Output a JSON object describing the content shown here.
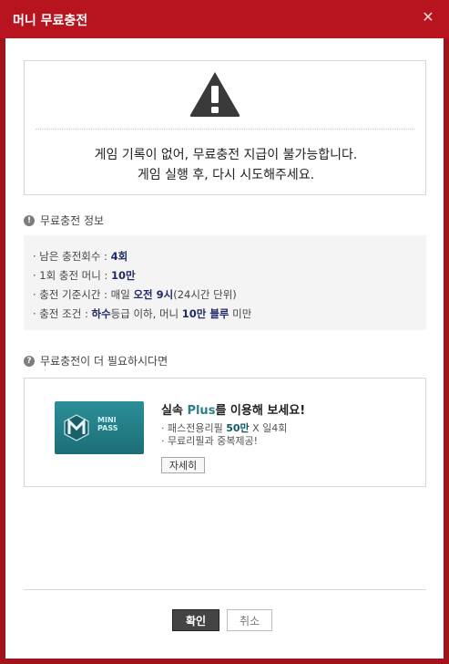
{
  "window": {
    "title": "머니 무료충전",
    "close_icon": "close-icon"
  },
  "notice": {
    "icon": "warning-icon",
    "line1": "게임 기록이 없어, 무료충전 지급이 불가능합니다.",
    "line2": "게임 실행 후, 다시 시도해주세요."
  },
  "info_section": {
    "heading": "무료충전 정보",
    "icon": "info-icon",
    "rows": [
      {
        "label": "· 남은 충전회수 : ",
        "value": "4회",
        "rest": ""
      },
      {
        "label": "· 1회 충전 머니 : ",
        "value": "10만",
        "rest": ""
      },
      {
        "label": "· 충전 기준시간 : 매일 ",
        "value": "오전 9시",
        "rest": "(24시간 단위)"
      },
      {
        "label": "· 충전 조건 : ",
        "value": "하수",
        "mid": "등급 이하, 머니 ",
        "value2": "10만 블루",
        "rest": " 미만"
      }
    ]
  },
  "pass_section": {
    "heading": "무료충전이 더 필요하시다면",
    "icon": "question-icon",
    "logo_text1": "MINI",
    "logo_text2": "PASS",
    "title_prefix": "실속 ",
    "title_plus": "Plus",
    "title_suffix": "를 이용해 보세요!",
    "line1_prefix": "· 패스전용리필 ",
    "line1_num": "50만",
    "line1_suffix": " X 일4회",
    "line2": "· 무료리필과 중복제공!",
    "detail_button": "자세히"
  },
  "footer": {
    "ok_button": "확인",
    "cancel_button": "취소"
  },
  "colors": {
    "window_frame": "#a3131b",
    "titlebar": "#b8141f",
    "highlight": "#1f2a66",
    "pass_accent": "#2b7f8b"
  }
}
